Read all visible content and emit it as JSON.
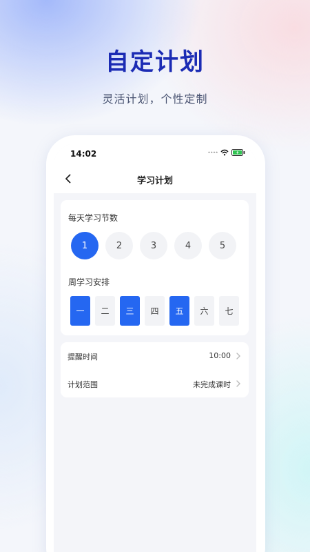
{
  "promo": {
    "title": "自定计划",
    "subtitle": "灵活计划，个性定制"
  },
  "status_bar": {
    "time": "14:02"
  },
  "nav": {
    "title": "学习计划"
  },
  "lessons": {
    "label": "每天学习节数",
    "options": [
      "1",
      "2",
      "3",
      "4",
      "5"
    ],
    "selected": "1"
  },
  "schedule": {
    "label": "周学习安排",
    "days": [
      "一",
      "二",
      "三",
      "四",
      "五",
      "六",
      "七"
    ],
    "selected": [
      "一",
      "三",
      "五"
    ]
  },
  "settings": {
    "reminder_label": "提醒时间",
    "reminder_value": "10:00",
    "scope_label": "计划范围",
    "scope_value": "未完成课时"
  },
  "colors": {
    "accent": "#2567f1",
    "headline": "#1b2bb4"
  }
}
